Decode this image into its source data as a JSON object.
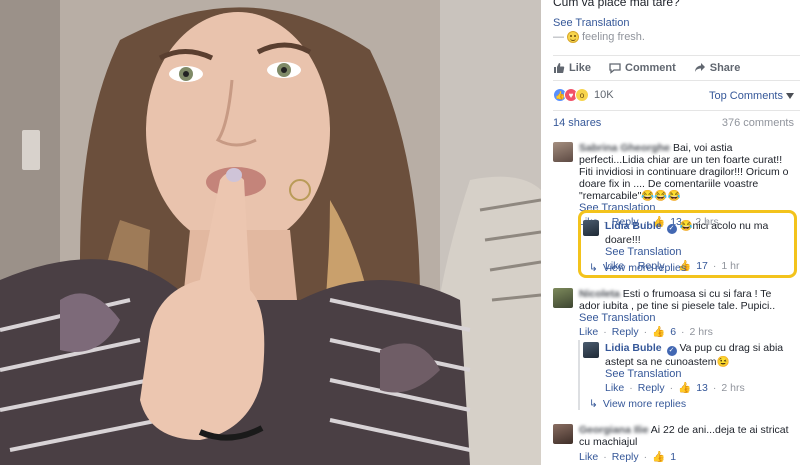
{
  "post": {
    "caption": "Cum va place mai tare?",
    "see_translation": "See Translation",
    "feeling": "— ",
    "feeling_text": "feeling fresh."
  },
  "actions": {
    "like": "Like",
    "comment": "Comment",
    "share": "Share"
  },
  "reactions": {
    "count": "10K",
    "types": [
      "like",
      "love",
      "wow"
    ]
  },
  "sort": {
    "label": "Top Comments"
  },
  "meta": {
    "shares": "14 shares",
    "comments": "376 comments"
  },
  "comments": [
    {
      "author": "Sabrina Gheorghe",
      "text": "Bai, voi astia perfecti...Lidia chiar are un ten foarte curat!! Fiti invidiosi in continuare dragilor!!! Oricum o doare fix in .... De comentariile voastre \"remarcabile\"😂😂😂",
      "see_translation": "See Translation",
      "like": "Like",
      "reply": "Reply",
      "likes": "13",
      "time": "2 hrs",
      "reply_item": {
        "author": "Lidia Buble",
        "text": "😂nici acolo nu ma doare!!!",
        "see_translation": "See Translation",
        "like": "Like",
        "reply": "Reply",
        "likes": "17",
        "time": "1 hr"
      },
      "more_replies": "View more replies"
    },
    {
      "author": "Nicoleta",
      "text": "Esti o frumoasa si cu si fara ! Te ador iubita , pe tine si piesele tale. Pupici..",
      "see_translation": "See Translation",
      "like": "Like",
      "reply": "Reply",
      "likes": "6",
      "time": "2 hrs",
      "reply_item": {
        "author": "Lidia Buble",
        "text": "Va pup cu drag si abia astept sa ne cunoastem😉",
        "see_translation": "See Translation",
        "like": "Like",
        "reply": "Reply",
        "likes": "13",
        "time": "2 hrs"
      },
      "more_replies": "View more replies"
    },
    {
      "author": "Georgiana Ilie",
      "text": "Ai 22 de ani...deja te ai stricat cu machiajul",
      "like": "Like",
      "reply": "Reply",
      "likes": "1"
    }
  ],
  "colors": {
    "link": "#365899",
    "highlight": "#f3c31c",
    "muted": "#90949c"
  }
}
